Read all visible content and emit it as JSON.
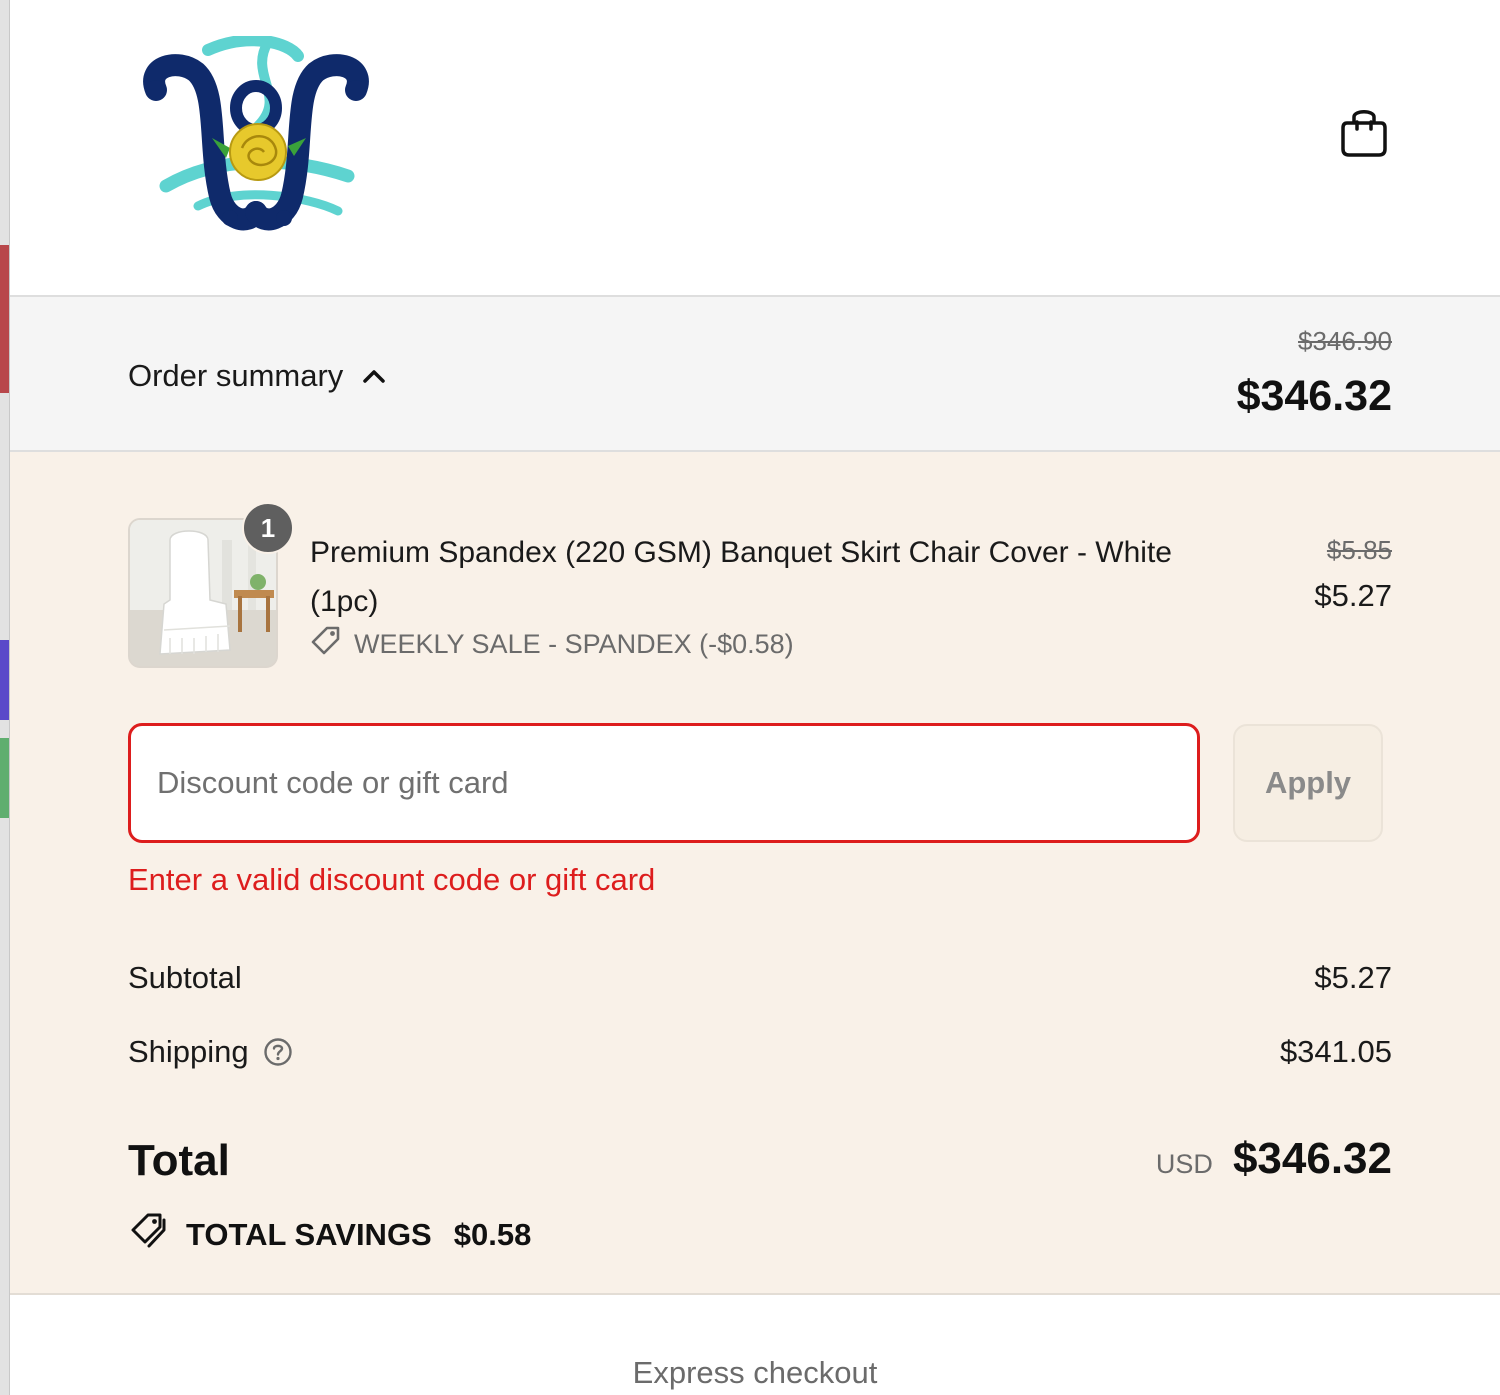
{
  "header": {
    "logo": "monogram-logo",
    "cart_icon": "shopping-bag-icon"
  },
  "summary": {
    "toggle_label": "Order summary",
    "toggle_icon": "chevron-up-icon",
    "original_total": "$346.90",
    "total": "$346.32"
  },
  "line_item": {
    "quantity": "1",
    "name": "Premium Spandex (220 GSM) Banquet Skirt Chair Cover - White (1pc)",
    "discount_icon": "tag-icon",
    "discount_label": "WEEKLY SALE - SPANDEX (-$0.58)",
    "original_price": "$5.85",
    "price": "$5.27"
  },
  "discount": {
    "placeholder": "Discount code or gift card",
    "value": "",
    "apply_label": "Apply",
    "error": "Enter a valid discount code or gift card"
  },
  "totals": {
    "subtotal_label": "Subtotal",
    "subtotal_value": "$5.27",
    "shipping_label": "Shipping",
    "shipping_help_icon": "question-circle-icon",
    "shipping_value": "$341.05",
    "total_label": "Total",
    "currency": "USD",
    "total_value": "$346.32",
    "savings_icon": "tags-icon",
    "savings_label": "TOTAL SAVINGS",
    "savings_value": "$0.58"
  },
  "express": {
    "label": "Express checkout"
  },
  "colors": {
    "error": "#dd1d1d",
    "summary_bg": "#f9f1e8",
    "bar_bg": "#f5f5f5",
    "logo_navy": "#0f2a6b",
    "logo_teal": "#5ed3d0",
    "logo_rose": "#e7c92c"
  }
}
